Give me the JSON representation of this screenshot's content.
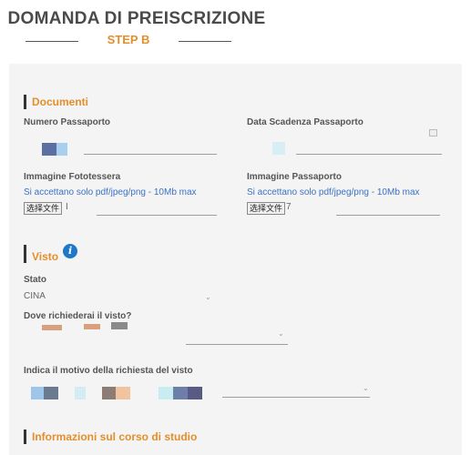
{
  "header": {
    "title": "DOMANDA DI PREISCRIZIONE",
    "step": "STEP B"
  },
  "documenti": {
    "section_title": "Documenti",
    "passport_number_label": "Numero Passaporto",
    "passport_expiry_label": "Data Scadenza Passaporto",
    "photo_label": "Immagine Fototessera",
    "photo_hint": "Si accettano solo pdf/jpeg/png - 10Mb max",
    "passport_image_label": "Immagine Passaporto",
    "passport_image_hint": "Si accettano solo pdf/jpeg/png - 10Mb max",
    "file_button_label": "选择文件",
    "photo_file_name": "I",
    "passport_file_name": "7",
    "calendar_icon": "calendar-icon"
  },
  "visto": {
    "section_title": "Visto",
    "info_icon_glyph": "i",
    "stato_label": "Stato",
    "stato_value": "CINA",
    "where_label": "Dove richiederai il visto?",
    "reason_label": "Indica il motivo della richiesta del visto",
    "chevron_icon": "chevron-down-icon"
  },
  "corso": {
    "section_title": "Informazioni sul corso di studio"
  },
  "colors": {
    "accent": "#e48e2c",
    "link": "#3a72c4",
    "info": "#1e78c8",
    "panel": "#f4f4f4"
  }
}
